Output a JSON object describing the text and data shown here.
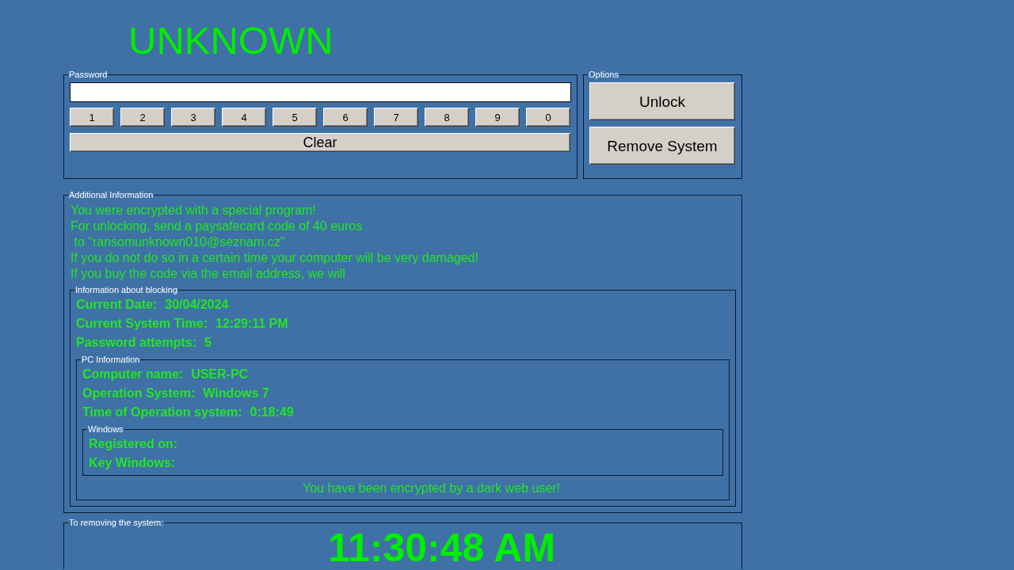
{
  "title": "UNKNOWN",
  "password_group": {
    "legend": "Password",
    "keypad": [
      "1",
      "2",
      "3",
      "4",
      "5",
      "6",
      "7",
      "8",
      "9",
      "0"
    ],
    "clear_button": "Clear"
  },
  "options_group": {
    "legend": "Options",
    "buttons": [
      "Unlock",
      "Remove System"
    ]
  },
  "additional_information": {
    "legend": "Additional Information",
    "message_lines": [
      "You were encrypted with a special program!",
      "For unlocking, send a paysafecard code of 40 euros",
      " to \"ransomunknown010@seznam.cz\"",
      "If you do not do so in a certain time your computer will be very damaged!",
      "If you buy the code via the email address, we will"
    ],
    "blocking_info": {
      "legend": "Information about blocking",
      "fields": [
        {
          "label": "Current Date:",
          "value": "30/04/2024"
        },
        {
          "label": "Current System Time:",
          "value": "12:29:11 PM"
        },
        {
          "label": "Password attempts:",
          "value": "5"
        }
      ],
      "pc_information": {
        "legend": "PC Information",
        "fields": [
          {
            "label": "Computer name:",
            "value": "USER-PC"
          },
          {
            "label": "Operation System:",
            "value": "Windows 7"
          },
          {
            "label": "Time of Operation system:",
            "value": "0:18:49"
          }
        ],
        "windows": {
          "legend": "Windows",
          "fields": [
            {
              "label": "Registered on:"
            },
            {
              "label": "Key Windows:"
            }
          ]
        },
        "footer": "You have been encrypted by a dark web user!"
      }
    }
  },
  "removal_group": {
    "legend": "To removing the system:",
    "countdown": "11:30:48 AM"
  }
}
